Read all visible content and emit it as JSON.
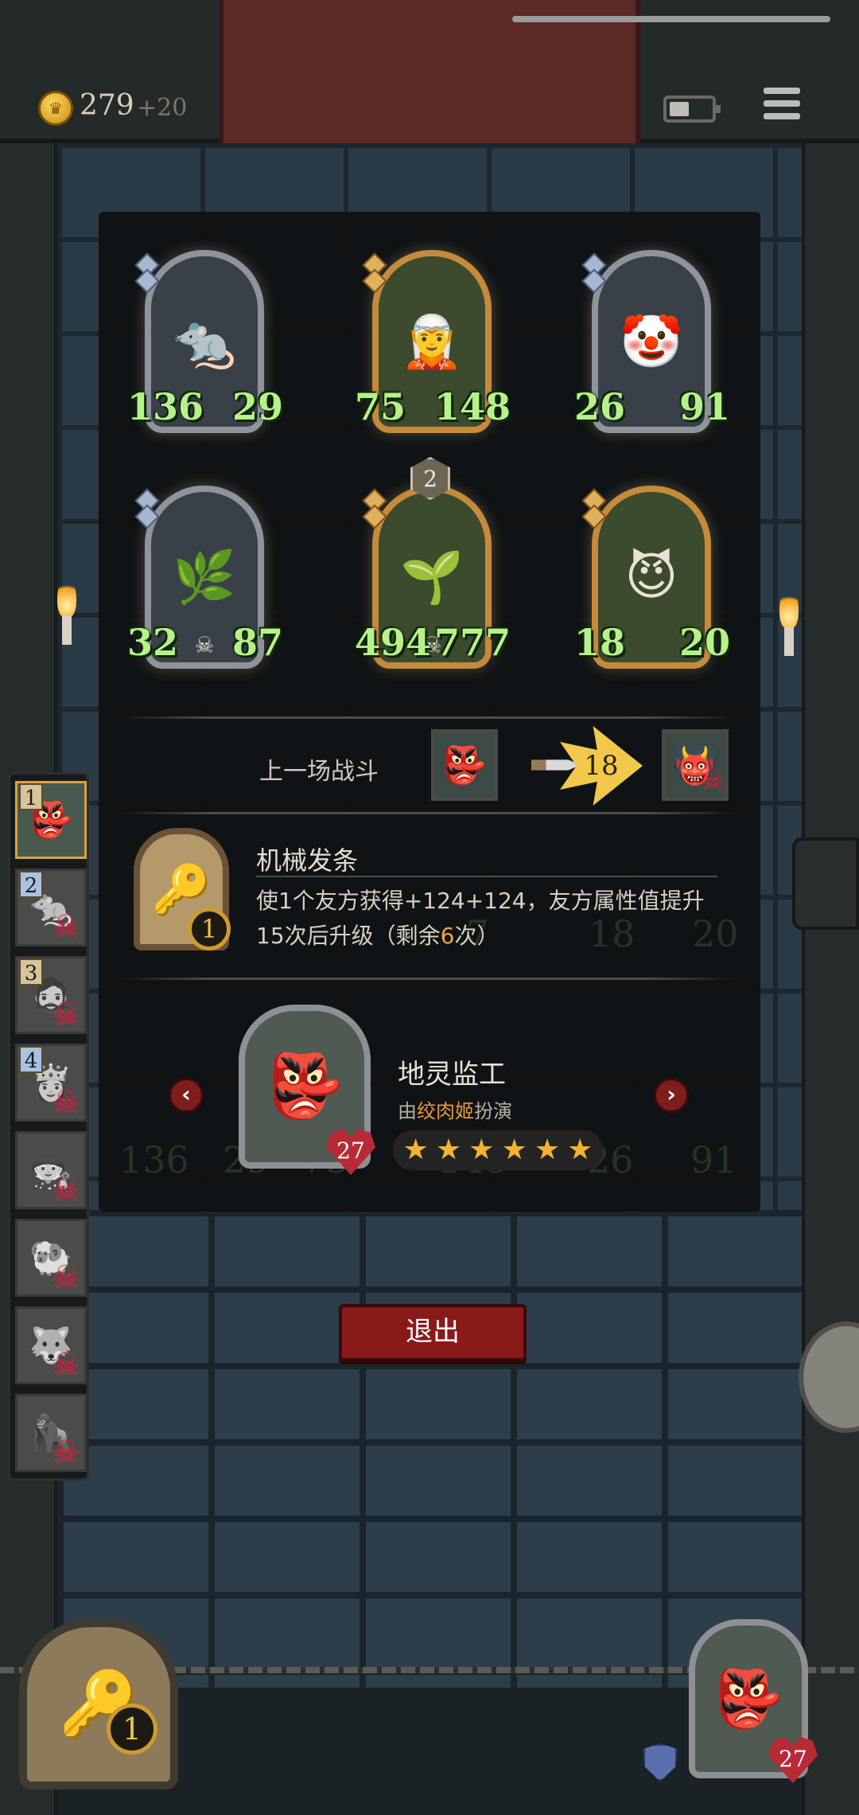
{
  "topbar": {
    "coins": "279",
    "coin_income": "+20",
    "icons": {
      "coin": "coin-icon",
      "battery": "battery-icon",
      "menu": "menu-icon"
    }
  },
  "board": {
    "units": [
      {
        "atk": "136",
        "hp": "29",
        "frame": "silver",
        "art": "🐀",
        "name": "rat-rogue"
      },
      {
        "atk": "75",
        "hp": "148",
        "frame": "gold",
        "art": "🧝",
        "name": "elf-sorceress"
      },
      {
        "atk": "26",
        "hp": "91",
        "frame": "silver",
        "art": "🤡",
        "name": "jester-clown"
      },
      {
        "atk": "32",
        "hp": "87",
        "frame": "silver",
        "art": "🌿",
        "name": "vine-plant"
      },
      {
        "atk": "494",
        "hp": "777",
        "frame": "gold",
        "art": "🌱",
        "name": "sprout-girl",
        "level": "2"
      },
      {
        "atk": "18",
        "hp": "20",
        "frame": "gold",
        "art": "😈",
        "name": "imp-grinner"
      }
    ]
  },
  "last_battle": {
    "label": "上一场战斗",
    "damage": "18"
  },
  "equipment": {
    "name": "机械发条",
    "description_line1": "使1个友方获得+124+124，友方属性值提升",
    "description_line2_prefix": "15次后升级（剩余",
    "description_line2_highlight": "6",
    "description_line2_suffix": "次）",
    "count": "1"
  },
  "hero": {
    "name": "地灵监工",
    "subtitle_prefix": "由",
    "subtitle_highlight": "绞肉姬",
    "subtitle_suffix": "扮演",
    "health": "27",
    "stars": 6,
    "art": "👺"
  },
  "ghost_stats": [
    "136",
    "29",
    "75",
    "148",
    "26",
    "91"
  ],
  "ghost_stats_mid": [
    "7",
    "18",
    "20"
  ],
  "actions": {
    "exit_label": "退出"
  },
  "team_list": [
    {
      "pos": "1",
      "active": true,
      "dead": false,
      "art": "👺",
      "pos_style": "tan"
    },
    {
      "pos": "2",
      "active": false,
      "dead": true,
      "art": "🐀",
      "pos_style": "blue"
    },
    {
      "pos": "3",
      "active": false,
      "dead": true,
      "art": "🧔",
      "pos_style": "tan"
    },
    {
      "pos": "4",
      "active": false,
      "dead": true,
      "art": "👸",
      "pos_style": "blue"
    },
    {
      "pos": "",
      "active": false,
      "dead": true,
      "art": "🧙",
      "pos_style": ""
    },
    {
      "pos": "",
      "active": false,
      "dead": true,
      "art": "🐏",
      "pos_style": ""
    },
    {
      "pos": "",
      "active": false,
      "dead": true,
      "art": "🐺",
      "pos_style": ""
    },
    {
      "pos": "",
      "active": false,
      "dead": true,
      "art": "🦍",
      "pos_style": ""
    }
  ],
  "bottom": {
    "equipment_count": "1",
    "hero_health": "27"
  }
}
